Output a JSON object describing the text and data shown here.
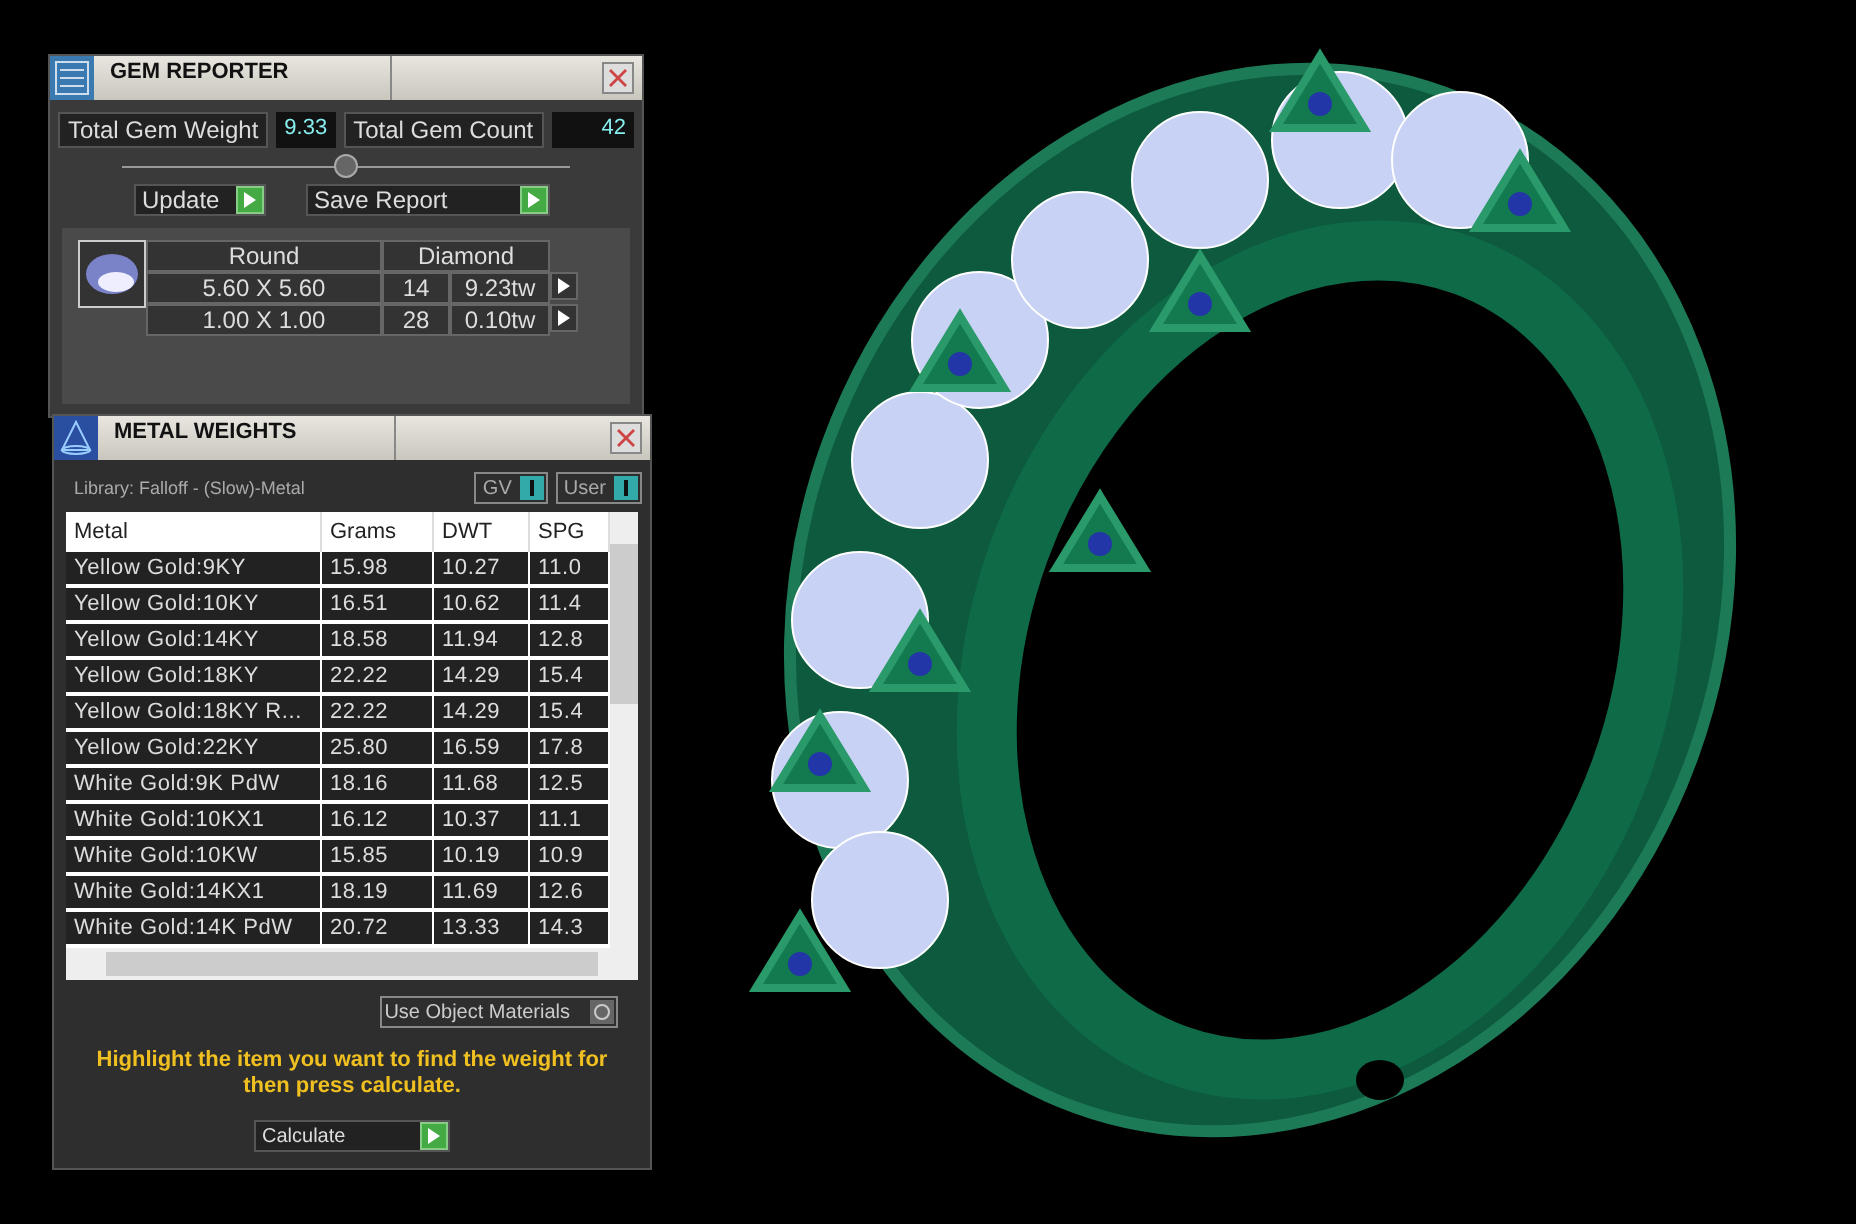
{
  "gem_reporter": {
    "title": "GEM REPORTER",
    "total_gem_weight": {
      "label": "Total Gem Weight",
      "value": "9.33"
    },
    "total_gem_count": {
      "label": "Total Gem Count",
      "value": "42"
    },
    "buttons": [
      "Update",
      "Save Report"
    ],
    "gem_table": {
      "shape": "Round",
      "material": "Diamond",
      "rows": [
        {
          "size": "5.60 X 5.60",
          "count": "14",
          "weight": "9.23tw"
        },
        {
          "size": "1.00 X 1.00",
          "count": "28",
          "weight": "0.10tw"
        }
      ]
    }
  },
  "metal_weights": {
    "title": "METAL WEIGHTS",
    "library": "Library: Falloff - (Slow)-Metal",
    "toggles": [
      {
        "label": "GV",
        "on": true
      },
      {
        "label": "User",
        "on": true
      }
    ],
    "columns": [
      "Metal",
      "Grams",
      "DWT",
      "SPG"
    ],
    "rows": [
      [
        "Yellow Gold:9KY",
        "15.98",
        "10.27",
        "11.0"
      ],
      [
        "Yellow Gold:10KY",
        "16.51",
        "10.62",
        "11.4"
      ],
      [
        "Yellow Gold:14KY",
        "18.58",
        "11.94",
        "12.8"
      ],
      [
        "Yellow Gold:18KY",
        "22.22",
        "14.29",
        "15.4"
      ],
      [
        "Yellow Gold:18KY R...",
        "22.22",
        "14.29",
        "15.4"
      ],
      [
        "Yellow Gold:22KY",
        "25.80",
        "16.59",
        "17.8"
      ],
      [
        "White Gold:9K PdW",
        "18.16",
        "11.68",
        "12.5"
      ],
      [
        "White Gold:10KX1",
        "16.12",
        "10.37",
        "11.1"
      ],
      [
        "White Gold:10KW",
        "15.85",
        "10.19",
        "10.9"
      ],
      [
        "White Gold:14KX1",
        "18.19",
        "11.69",
        "12.6"
      ],
      [
        "White Gold:14K PdW",
        "20.72",
        "13.33",
        "14.3"
      ]
    ],
    "option": {
      "label": "Use Object Materials",
      "checked": false
    },
    "instruction": "Highlight the item you want to find the weight for then press calculate.",
    "button": "Calculate"
  }
}
